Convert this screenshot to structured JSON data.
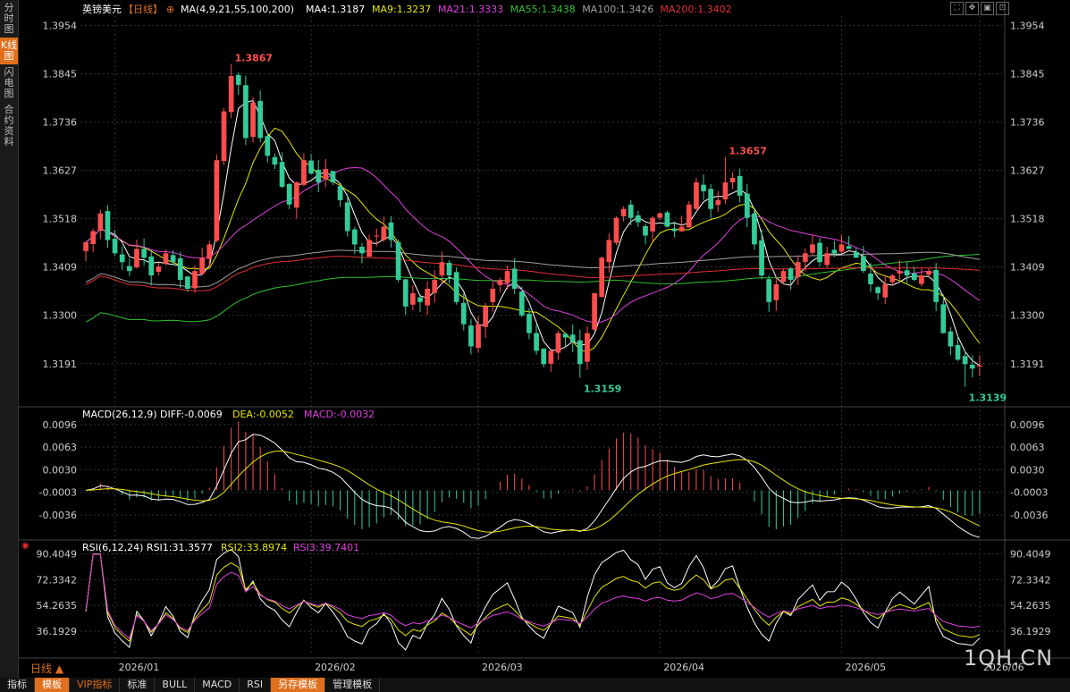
{
  "sidebar": {
    "tabs": [
      {
        "label": "分时图",
        "active": false
      },
      {
        "label": "K线图",
        "active": true
      },
      {
        "label": "闪电图",
        "active": false
      },
      {
        "label": "合约资料",
        "active": false
      }
    ]
  },
  "header": {
    "instrument": "英镑美元",
    "period": "【日线】",
    "ma_label": "MA(4,9,21,55,100,200)",
    "ma_values": [
      {
        "text": "MA4:1.3187",
        "color": "#ffffff"
      },
      {
        "text": "MA9:1.3237",
        "color": "#e6e600"
      },
      {
        "text": "MA21:1.3333",
        "color": "#e040e0"
      },
      {
        "text": "MA55:1.3438",
        "color": "#30c030"
      },
      {
        "text": "MA100:1.3426",
        "color": "#a0a0a0"
      },
      {
        "text": "MA200:1.3402",
        "color": "#e03030"
      }
    ]
  },
  "toolbar_icons": [
    "fullscreen-icon",
    "move-icon",
    "fit-icon",
    "zoom-icon"
  ],
  "chart_data": {
    "type": "candlestick",
    "title": "英镑美元 日线",
    "price_axis": {
      "ticks": [
        "1.3954",
        "1.3845",
        "1.3736",
        "1.3627",
        "1.3518",
        "1.3409",
        "1.3300",
        "1.3191"
      ],
      "range": [
        1.312,
        1.3975
      ]
    },
    "date_ticks": [
      "2026/01",
      "2026/02",
      "2026/03",
      "2026/04",
      "2026/05",
      "2026/06"
    ],
    "annotations": [
      {
        "text": "1.3867",
        "value": 1.3867,
        "type": "high"
      },
      {
        "text": "1.3657",
        "value": 1.3657,
        "type": "high"
      },
      {
        "text": "1.3159",
        "value": 1.3159,
        "type": "low"
      },
      {
        "text": "1.3139",
        "value": 1.3139,
        "type": "low"
      }
    ],
    "close_path": [
      1.3465,
      1.349,
      1.353,
      1.347,
      1.344,
      1.342,
      1.34,
      1.345,
      1.343,
      1.339,
      1.341,
      1.344,
      1.342,
      1.338,
      1.336,
      1.34,
      1.343,
      1.346,
      1.365,
      1.376,
      1.384,
      1.382,
      1.37,
      1.378,
      1.37,
      1.366,
      1.364,
      1.359,
      1.355,
      1.36,
      1.365,
      1.362,
      1.36,
      1.363,
      1.36,
      1.356,
      1.349,
      1.346,
      1.344,
      1.347,
      1.348,
      1.35,
      1.347,
      1.338,
      1.332,
      1.335,
      1.333,
      1.336,
      1.338,
      1.342,
      1.339,
      1.333,
      1.328,
      1.323,
      1.328,
      1.332,
      1.336,
      1.338,
      1.34,
      1.336,
      1.33,
      1.326,
      1.322,
      1.319,
      1.322,
      1.326,
      1.325,
      1.324,
      1.319,
      1.326,
      1.335,
      1.343,
      1.347,
      1.352,
      1.354,
      1.352,
      1.351,
      1.348,
      1.352,
      1.353,
      1.35,
      1.349,
      1.35,
      1.355,
      1.36,
      1.358,
      1.354,
      1.356,
      1.36,
      1.361,
      1.357,
      1.352,
      1.346,
      1.339,
      1.333,
      1.337,
      1.34,
      1.338,
      1.342,
      1.344,
      1.346,
      1.342,
      1.344,
      1.344,
      1.346,
      1.345,
      1.343,
      1.34,
      1.337,
      1.335,
      1.337,
      1.339,
      1.34,
      1.339,
      1.338,
      1.339,
      1.34,
      1.333,
      1.326,
      1.323,
      1.32,
      1.319,
      1.318,
      1.3187
    ],
    "macd": {
      "label": "MACD(26,12,9)",
      "diff_text": "DIFF:-0.0069",
      "dea_text": "DEA:-0.0052",
      "macd_text": "MACD:-0.0032",
      "ticks": [
        "0.0096",
        "0.0063",
        "0.0030",
        "-0.0003",
        "-0.0036"
      ],
      "range": [
        -0.007,
        0.0105
      ]
    },
    "rsi": {
      "label": "RSI(6,12,24)",
      "rsi1_text": "RSI1:31.3577",
      "rsi2_text": "RSI2:33.8974",
      "rsi3_text": "RSI3:39.7401",
      "ticks": [
        "90.4049",
        "72.3342",
        "54.2635",
        "36.1929"
      ],
      "range": [
        20,
        95
      ]
    }
  },
  "period_label": "日线",
  "bottom_tabs": [
    {
      "label": "指标",
      "hl": false
    },
    {
      "label": "模板",
      "hl": true
    },
    {
      "label": "VIP指标",
      "hl": false,
      "color": "#e0701e"
    },
    {
      "label": "标准",
      "hl": false
    },
    {
      "label": "BULL",
      "hl": false
    },
    {
      "label": "MACD",
      "hl": false
    },
    {
      "label": "RSI",
      "hl": false
    },
    {
      "label": "另存模板",
      "hl": true
    },
    {
      "label": "管理模板",
      "hl": false
    }
  ],
  "watermark": "1QH.CN",
  "colors": {
    "up": "#ff4d4d",
    "down": "#33cc99",
    "grid": "#333333",
    "axis_text": "#cccccc"
  }
}
